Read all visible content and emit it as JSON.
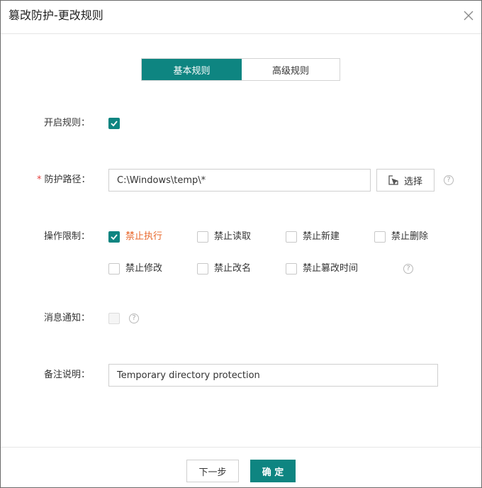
{
  "dialog": {
    "title": "篡改防护-更改规则",
    "close_icon": "close-icon"
  },
  "tabs": [
    {
      "label": "基本规则",
      "active": true
    },
    {
      "label": "高级规则",
      "active": false
    }
  ],
  "form": {
    "enable_rule": {
      "label": "开启规则：",
      "checked": true
    },
    "protect_path": {
      "required_mark": "*",
      "label": "防护路径：",
      "value": "C:\\Windows\\temp\\*",
      "select_button": "选择",
      "select_icon": "select-cursor-icon"
    },
    "operation_limits": {
      "label": "操作限制：",
      "options": [
        {
          "label": "禁止执行",
          "checked": true
        },
        {
          "label": "禁止读取",
          "checked": false
        },
        {
          "label": "禁止新建",
          "checked": false
        },
        {
          "label": "禁止删除",
          "checked": false
        },
        {
          "label": "禁止修改",
          "checked": false
        },
        {
          "label": "禁止改名",
          "checked": false
        },
        {
          "label": "禁止篡改时间",
          "checked": false
        }
      ]
    },
    "notify": {
      "label": "消息通知：",
      "checked": false,
      "disabled": true
    },
    "remark": {
      "label": "备注说明：",
      "value": "Temporary directory protection"
    }
  },
  "help_glyph": "?",
  "footer": {
    "next_button": "下一步",
    "ok_button": "确 定"
  },
  "colors": {
    "accent": "#0e8581",
    "active_option": "#e8662a",
    "required": "#e64340"
  }
}
